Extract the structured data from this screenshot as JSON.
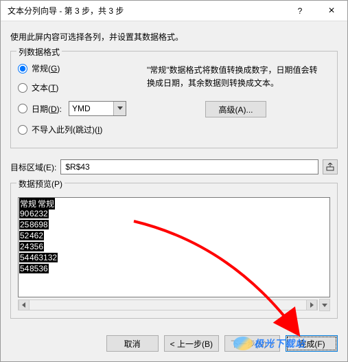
{
  "titlebar": {
    "title": "文本分列向导 - 第 3 步，共 3 步",
    "help": "?",
    "close": "×"
  },
  "instruction": "使用此屏内容可选择各列，并设置其数据格式。",
  "col_format": {
    "legend": "列数据格式",
    "general": "常规(G)",
    "text": "文本(T)",
    "date": "日期(D):",
    "date_value": "YMD",
    "skip": "不导入此列(跳过)(I)"
  },
  "desc": "\"常规\"数据格式将数值转换成数字，日期值会转换成日期，其余数据则转换成文本。",
  "advanced": "高级(A)...",
  "target": {
    "label": "目标区域(E):",
    "value": "$R$43"
  },
  "preview": {
    "legend": "数据预览(P)",
    "headers": [
      "常规",
      "常规"
    ],
    "rows": [
      [
        "90",
        "6232"
      ],
      [
        "25",
        "8698"
      ],
      [
        "52",
        "462"
      ],
      [
        "24",
        "356"
      ],
      [
        "54",
        "463132"
      ],
      [
        "54",
        "8536"
      ]
    ]
  },
  "buttons": {
    "cancel": "取消",
    "back": "< 上一步(B)",
    "next": "下一步(N) >",
    "finish": "完成(F)"
  },
  "watermark": "极光下载站"
}
